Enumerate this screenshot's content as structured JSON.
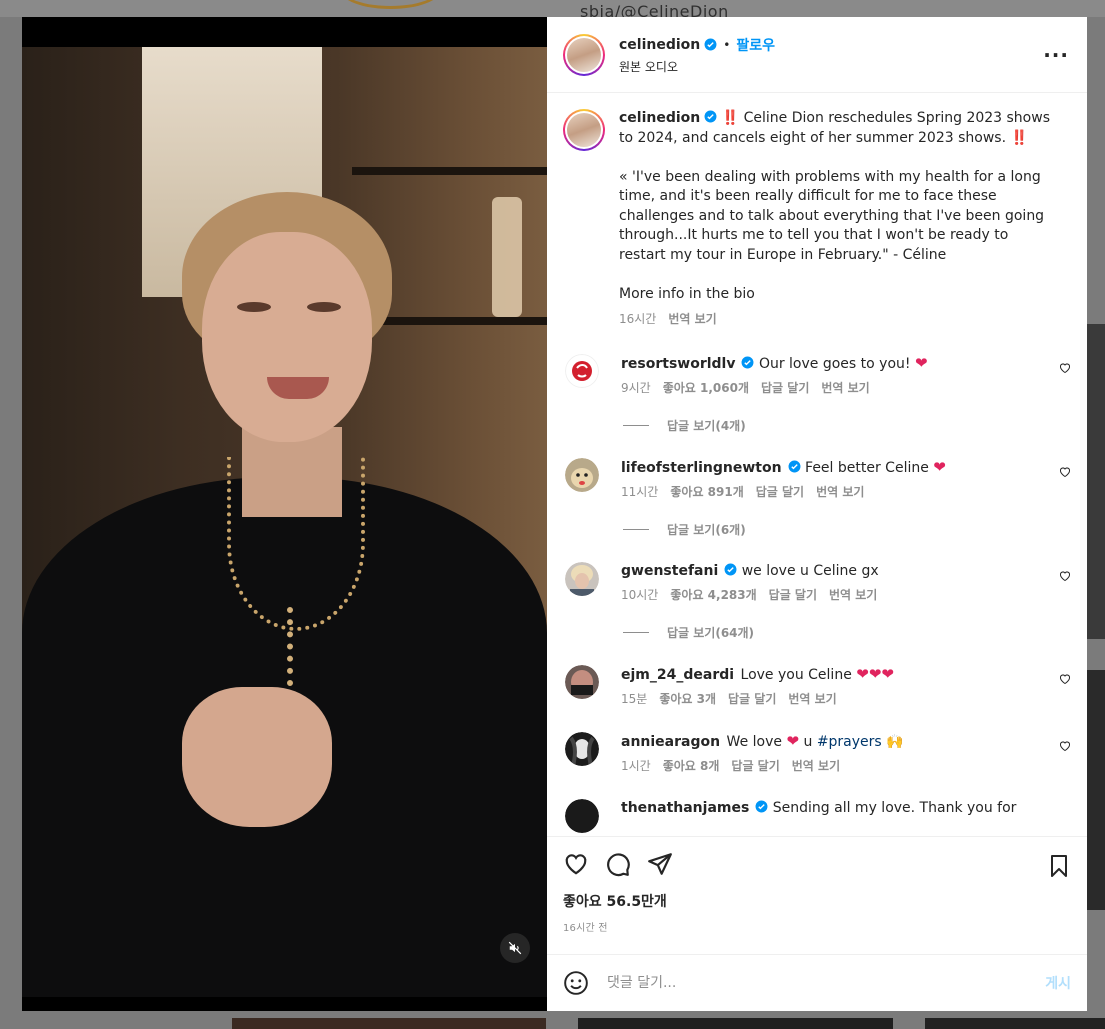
{
  "background": {
    "partial_username": "sbia/@CelineDion"
  },
  "post": {
    "author": "celinedion",
    "follow_label": "팔로우",
    "audio_label": "원본 오디오",
    "caption": {
      "author": "celinedion",
      "text": "‼️ Celine Dion reschedules Spring 2023 shows to 2024, and cancels eight of her summer 2023 shows. ‼️\n\n« 'I've been dealing with problems with my health for a long time, and it's been really difficult for me to face these challenges and to talk about everything that I've been going through...It hurts me to tell you that I won't be ready to restart my tour in Europe in February.\" - Céline\n\nMore info in the bio",
      "time": "16시간",
      "translate": "번역 보기"
    },
    "comments": [
      {
        "user": "resortsworldlv",
        "verified": true,
        "text": "Our love goes to you!",
        "emoji": "❤",
        "time": "9시간",
        "likes": "좋아요 1,060개",
        "reply": "답글 달기",
        "translate": "번역 보기",
        "view_replies": "답글 보기(4개)"
      },
      {
        "user": "lifeofsterlingnewton",
        "verified": true,
        "text": "Feel better Celine",
        "emoji": "❤",
        "time": "11시간",
        "likes": "좋아요 891개",
        "reply": "답글 달기",
        "translate": "번역 보기",
        "view_replies": "답글 보기(6개)"
      },
      {
        "user": "gwenstefani",
        "verified": true,
        "text": "we love u Celine gx",
        "emoji": "",
        "time": "10시간",
        "likes": "좋아요 4,283개",
        "reply": "답글 달기",
        "translate": "번역 보기",
        "view_replies": "답글 보기(64개)"
      },
      {
        "user": "ejm_24_deardi",
        "verified": false,
        "text": "Love you Celine",
        "emoji": "❤❤❤",
        "time": "15분",
        "likes": "좋아요 3개",
        "reply": "답글 달기",
        "translate": "번역 보기",
        "view_replies": ""
      },
      {
        "user": "anniearagon",
        "verified": false,
        "text_before": "We love",
        "emoji": "❤",
        "text_after": "u",
        "hashtag": "#prayers",
        "emoji2": "🙌",
        "time": "1시간",
        "likes": "좋아요 8개",
        "reply": "답글 달기",
        "translate": "번역 보기"
      },
      {
        "user": "thenathanjames",
        "verified": true,
        "text": "Sending all my love. Thank you for"
      }
    ],
    "likes_count": "좋아요 56.5만개",
    "posted_ago": "16시간 전",
    "comment_placeholder": "댓글 달기...",
    "post_button": "게시"
  },
  "colors": {
    "accent": "#0095f6",
    "post_disabled": "#b2dffc",
    "heart_red": "#e0245e",
    "overlay": "#7b7b7b"
  },
  "icons": [
    "verified-badge-icon",
    "more-icon",
    "heart-icon",
    "comment-icon",
    "share-icon",
    "save-icon",
    "emoji-icon",
    "mute-icon"
  ]
}
